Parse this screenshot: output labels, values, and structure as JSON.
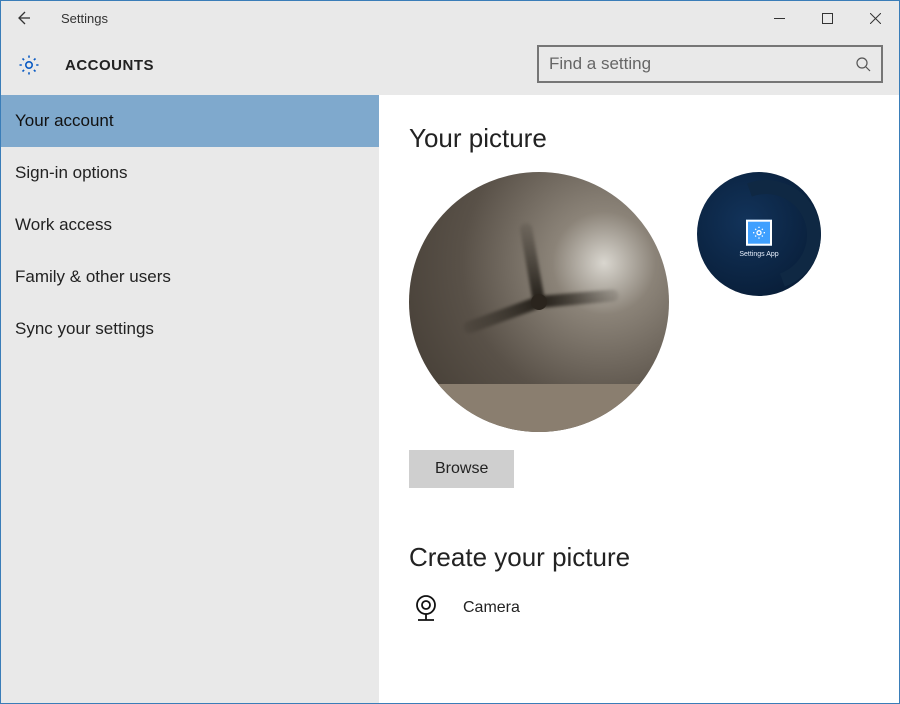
{
  "window": {
    "title": "Settings"
  },
  "header": {
    "category": "ACCOUNTS",
    "search_placeholder": "Find a setting"
  },
  "sidebar": {
    "items": [
      {
        "label": "Your account",
        "active": true
      },
      {
        "label": "Sign-in options",
        "active": false
      },
      {
        "label": "Work access",
        "active": false
      },
      {
        "label": "Family & other users",
        "active": false
      },
      {
        "label": "Sync your settings",
        "active": false
      }
    ]
  },
  "main": {
    "your_picture_heading": "Your picture",
    "browse_label": "Browse",
    "create_heading": "Create your picture",
    "camera_label": "Camera",
    "thumbnail_caption": "Settings App"
  }
}
